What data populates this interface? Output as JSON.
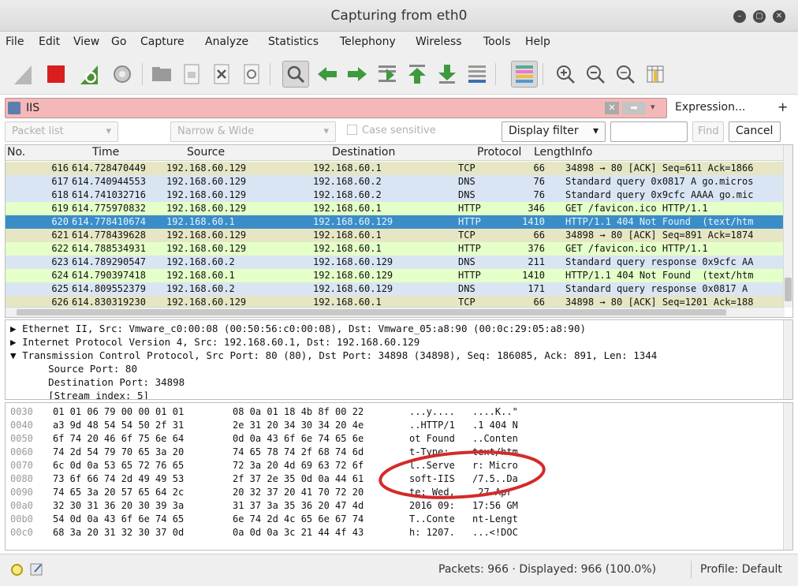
{
  "window": {
    "title": "Capturing from eth0"
  },
  "menu": [
    "File",
    "Edit",
    "View",
    "Go",
    "Capture",
    "Analyze",
    "Statistics",
    "Telephony",
    "Wireless",
    "Tools",
    "Help"
  ],
  "filter": {
    "value": "IIS",
    "expression_label": "Expression...",
    "add_label": "+"
  },
  "find": {
    "scope": "Packet list",
    "mode": "Narrow & Wide",
    "case_label": "Case sensitive",
    "type": "Display filter",
    "find_label": "Find",
    "cancel_label": "Cancel"
  },
  "packet_list": {
    "columns": [
      "No.",
      "Time",
      "Source",
      "Destination",
      "Protocol",
      "Length",
      "Info"
    ],
    "rows": [
      {
        "no": "616",
        "time": "614.728470449",
        "src": "192.168.60.129",
        "dst": "192.168.60.1",
        "proto": "TCP",
        "len": "66",
        "info": "34898 → 80 [ACK] Seq=611 Ack=1866",
        "kind": "tcp"
      },
      {
        "no": "617",
        "time": "614.740944553",
        "src": "192.168.60.129",
        "dst": "192.168.60.2",
        "proto": "DNS",
        "len": "76",
        "info": "Standard query 0x0817 A go.micros",
        "kind": "udp"
      },
      {
        "no": "618",
        "time": "614.741032716",
        "src": "192.168.60.129",
        "dst": "192.168.60.2",
        "proto": "DNS",
        "len": "76",
        "info": "Standard query 0x9cfc AAAA go.mic",
        "kind": "udp"
      },
      {
        "no": "619",
        "time": "614.775970832",
        "src": "192.168.60.129",
        "dst": "192.168.60.1",
        "proto": "HTTP",
        "len": "346",
        "info": "GET /favicon.ico HTTP/1.1",
        "kind": "http"
      },
      {
        "no": "620",
        "time": "614.778410674",
        "src": "192.168.60.1",
        "dst": "192.168.60.129",
        "proto": "HTTP",
        "len": "1410",
        "info": "HTTP/1.1 404 Not Found  (text/htm",
        "kind": "sel"
      },
      {
        "no": "621",
        "time": "614.778439628",
        "src": "192.168.60.129",
        "dst": "192.168.60.1",
        "proto": "TCP",
        "len": "66",
        "info": "34898 → 80 [ACK] Seq=891 Ack=1874",
        "kind": "tcp"
      },
      {
        "no": "622",
        "time": "614.788534931",
        "src": "192.168.60.129",
        "dst": "192.168.60.1",
        "proto": "HTTP",
        "len": "376",
        "info": "GET /favicon.ico HTTP/1.1",
        "kind": "http"
      },
      {
        "no": "623",
        "time": "614.789290547",
        "src": "192.168.60.2",
        "dst": "192.168.60.129",
        "proto": "DNS",
        "len": "211",
        "info": "Standard query response 0x9cfc AA",
        "kind": "udp"
      },
      {
        "no": "624",
        "time": "614.790397418",
        "src": "192.168.60.1",
        "dst": "192.168.60.129",
        "proto": "HTTP",
        "len": "1410",
        "info": "HTTP/1.1 404 Not Found  (text/htm",
        "kind": "http"
      },
      {
        "no": "625",
        "time": "614.809552379",
        "src": "192.168.60.2",
        "dst": "192.168.60.129",
        "proto": "DNS",
        "len": "171",
        "info": "Standard query response 0x0817 A",
        "kind": "udp"
      },
      {
        "no": "626",
        "time": "614.830319230",
        "src": "192.168.60.129",
        "dst": "192.168.60.1",
        "proto": "TCP",
        "len": "66",
        "info": "34898 → 80 [ACK] Seq=1201 Ack=188",
        "kind": "tcp"
      }
    ]
  },
  "details": [
    {
      "arrow": "▶",
      "text": "Ethernet II, Src: Vmware_c0:00:08 (00:50:56:c0:00:08), Dst: Vmware_05:a8:90 (00:0c:29:05:a8:90)"
    },
    {
      "arrow": "▶",
      "text": "Internet Protocol Version 4, Src: 192.168.60.1, Dst: 192.168.60.129"
    },
    {
      "arrow": "▼",
      "text": "Transmission Control Protocol, Src Port: 80 (80), Dst Port: 34898 (34898), Seq: 186085, Ack: 891, Len: 1344"
    },
    {
      "arrow": "",
      "text": "    Source Port: 80"
    },
    {
      "arrow": "",
      "text": "    Destination Port: 34898"
    },
    {
      "arrow": "",
      "text": "    [Stream index: 5]"
    }
  ],
  "hex": [
    {
      "off": "0030",
      "b1": "01 01 06 79 00 00 01 01",
      "b2": "08 0a 01 18 4b 8f 00 22",
      "a1": "...y....",
      "a2": "....K..\""
    },
    {
      "off": "0040",
      "b1": "a3 9d 48 54 54 50 2f 31",
      "b2": "2e 31 20 34 30 34 20 4e",
      "a1": "..HTTP/1",
      "a2": ".1 404 N"
    },
    {
      "off": "0050",
      "b1": "6f 74 20 46 6f 75 6e 64",
      "b2": "0d 0a 43 6f 6e 74 65 6e",
      "a1": "ot Found",
      "a2": "..Conten"
    },
    {
      "off": "0060",
      "b1": "74 2d 54 79 70 65 3a 20",
      "b2": "74 65 78 74 2f 68 74 6d",
      "a1": "t-Type: ",
      "a2": "text/htm"
    },
    {
      "off": "0070",
      "b1": "6c 0d 0a 53 65 72 76 65",
      "b2": "72 3a 20 4d 69 63 72 6f",
      "a1": "l..Serve",
      "a2": "r: Micro"
    },
    {
      "off": "0080",
      "b1": "73 6f 66 74 2d 49 49 53",
      "b2": "2f 37 2e 35 0d 0a 44 61",
      "a1": "soft-IIS",
      "a2": "/7.5..Da"
    },
    {
      "off": "0090",
      "b1": "74 65 3a 20 57 65 64 2c",
      "b2": "20 32 37 20 41 70 72 20",
      "a1": "te: Wed,",
      "a2": " 27 Apr "
    },
    {
      "off": "00a0",
      "b1": "32 30 31 36 20 30 39 3a",
      "b2": "31 37 3a 35 36 20 47 4d",
      "a1": "2016 09:",
      "a2": "17:56 GM"
    },
    {
      "off": "00b0",
      "b1": "54 0d 0a 43 6f 6e 74 65",
      "b2": "6e 74 2d 4c 65 6e 67 74",
      "a1": "T..Conte",
      "a2": "nt-Lengt"
    },
    {
      "off": "00c0",
      "b1": "68 3a 20 31 32 30 37 0d",
      "b2": "0a 0d 0a 3c 21 44 4f 43",
      "a1": "h: 1207.",
      "a2": "...<!DOC"
    }
  ],
  "status": {
    "packets": "Packets: 966 · Displayed: 966 (100.0%)",
    "profile": "Profile: Default"
  },
  "colors": {
    "selected": "#3b8dc8",
    "filter_bg": "#f5b8b8",
    "highlight_circle": "#d42a2a"
  }
}
